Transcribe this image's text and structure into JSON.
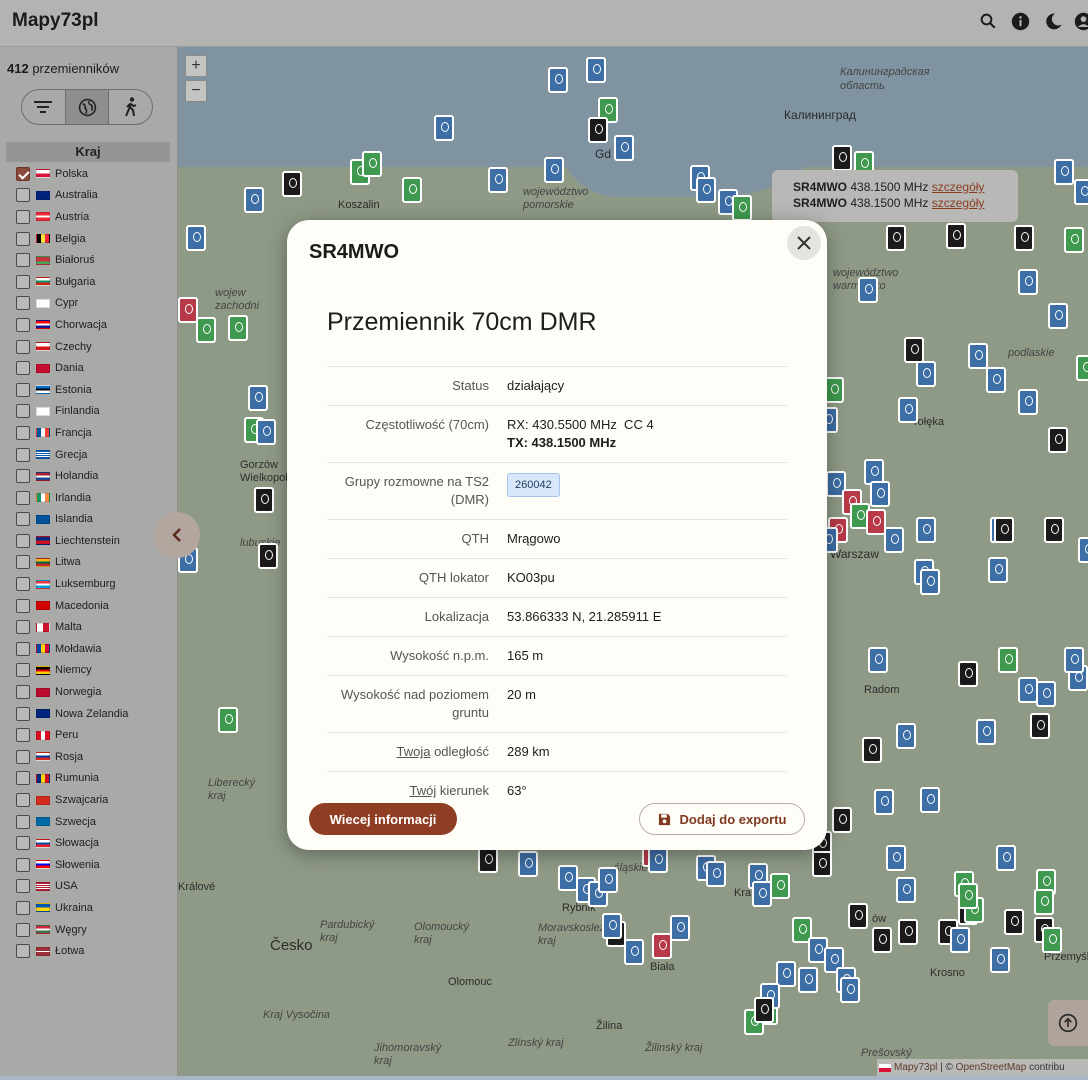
{
  "header": {
    "title": "Mapy73pl"
  },
  "sidebar": {
    "count_number": "412",
    "count_label": " przemienników",
    "kraj_header": "Kraj",
    "countries": [
      {
        "name": "Polska",
        "checked": true,
        "flag": "pl"
      },
      {
        "name": "Australia",
        "checked": false,
        "flag": "au"
      },
      {
        "name": "Austria",
        "checked": false,
        "flag": "at"
      },
      {
        "name": "Belgia",
        "checked": false,
        "flag": "be"
      },
      {
        "name": "Białoruś",
        "checked": false,
        "flag": "by"
      },
      {
        "name": "Bułgaria",
        "checked": false,
        "flag": "bg"
      },
      {
        "name": "Cypr",
        "checked": false,
        "flag": "cy"
      },
      {
        "name": "Chorwacja",
        "checked": false,
        "flag": "hr"
      },
      {
        "name": "Czechy",
        "checked": false,
        "flag": "cz"
      },
      {
        "name": "Dania",
        "checked": false,
        "flag": "dk"
      },
      {
        "name": "Estonia",
        "checked": false,
        "flag": "ee"
      },
      {
        "name": "Finlandia",
        "checked": false,
        "flag": "fi"
      },
      {
        "name": "Francja",
        "checked": false,
        "flag": "fr"
      },
      {
        "name": "Grecja",
        "checked": false,
        "flag": "gr"
      },
      {
        "name": "Holandia",
        "checked": false,
        "flag": "nl"
      },
      {
        "name": "Irlandia",
        "checked": false,
        "flag": "ie"
      },
      {
        "name": "Islandia",
        "checked": false,
        "flag": "is"
      },
      {
        "name": "Liechtenstein",
        "checked": false,
        "flag": "li"
      },
      {
        "name": "Litwa",
        "checked": false,
        "flag": "lt"
      },
      {
        "name": "Luksemburg",
        "checked": false,
        "flag": "lu"
      },
      {
        "name": "Macedonia",
        "checked": false,
        "flag": "mk"
      },
      {
        "name": "Malta",
        "checked": false,
        "flag": "mt"
      },
      {
        "name": "Mołdawia",
        "checked": false,
        "flag": "md"
      },
      {
        "name": "Niemcy",
        "checked": false,
        "flag": "de"
      },
      {
        "name": "Norwegia",
        "checked": false,
        "flag": "no"
      },
      {
        "name": "Nowa Zelandia",
        "checked": false,
        "flag": "nz"
      },
      {
        "name": "Peru",
        "checked": false,
        "flag": "pe"
      },
      {
        "name": "Rosja",
        "checked": false,
        "flag": "ru"
      },
      {
        "name": "Rumunia",
        "checked": false,
        "flag": "ro"
      },
      {
        "name": "Szwajcaria",
        "checked": false,
        "flag": "ch"
      },
      {
        "name": "Szwecja",
        "checked": false,
        "flag": "se"
      },
      {
        "name": "Słowacja",
        "checked": false,
        "flag": "sk"
      },
      {
        "name": "Słowenia",
        "checked": false,
        "flag": "si"
      },
      {
        "name": "USA",
        "checked": false,
        "flag": "us"
      },
      {
        "name": "Ukraina",
        "checked": false,
        "flag": "ua"
      },
      {
        "name": "Węgry",
        "checked": false,
        "flag": "hu"
      },
      {
        "name": "Łotwa",
        "checked": false,
        "flag": "lv"
      }
    ]
  },
  "map": {
    "labels": {
      "kaliningrad_oblast": "Калининградская область",
      "kaliningrad": "Калининград",
      "koszalin": "Koszalin",
      "pomorskie": "województwo pomorskie",
      "warminsko": "województwo warmińsko",
      "podlaskie": "podlaskie",
      "gorzow": "Gorzów Wielkopolski",
      "lubuskie": "lubuskie",
      "radom": "Radom",
      "liberecky": "Liberecký kraj",
      "krolove": "Králové",
      "cesko": "Česko",
      "pardubicky": "Pardubický kraj",
      "olomoucky": "Olomoucký kraj",
      "olomouc": "Olomouc",
      "rybnik": "Rybnik",
      "morawskoslaskie": "Moravskoslezský kraj",
      "biala": "Biała",
      "krosno": "Krosno",
      "przemysl": "Przemyśl",
      "zilina": "Žilina",
      "zilinsky": "Žilinský kraj",
      "presovsky": "Prešovský",
      "jihomoravsky": "Jihomoravský kraj",
      "zlinsky": "Zlínský kraj",
      "vysocina": "Kraj Vysočina",
      "olka": "rołęka",
      "warszawa": "Warszaw",
      "zachodnio": "wojew zachodni",
      "slaskie": "śląskie",
      "krakow": "Kra",
      "rzeszow": "ów",
      "gdansk": "Gd"
    },
    "tooltip": {
      "lines": [
        {
          "callsign": "SR4MWO",
          "freq": "438.1500 MHz",
          "link": "szczegóły"
        },
        {
          "callsign": "SR4MWO",
          "freq": "438.1500 MHz",
          "link": "szczegóły"
        }
      ]
    },
    "attribution": {
      "brand": "Mapy73pl",
      "sep": "| ©",
      "osm": "OpenStreetMap",
      "suffix": "contribu"
    },
    "zoom_in": "+",
    "zoom_out": "−"
  },
  "modal": {
    "title": "SR4MWO",
    "heading": "Przemiennik 70cm DMR",
    "rows": {
      "status_label": "Status",
      "status_value": "działający",
      "freq_label": "Częstotliwość (70cm)",
      "freq_rx": "RX: 430.5500 MHz  CC 4",
      "freq_tx": "TX: 438.1500 MHz",
      "groups_label": "Grupy rozmowne na TS2 (DMR)",
      "groups_badge": "260042",
      "qth_label": "QTH",
      "qth_value": "Mrągowo",
      "locator_label": "QTH lokator",
      "locator_value": "KO03pu",
      "location_label": "Lokalizacja",
      "location_value": "53.866333 N, 21.285911 E",
      "altitude_label": "Wysokość n.p.m.",
      "altitude_value": "165 m",
      "height_label": "Wysokość nad poziomem gruntu",
      "height_value": "20 m",
      "distance_label_link": "Twoja",
      "distance_label_rest": " odległość",
      "distance_value": "289 km",
      "bearing_label_link": "Twój",
      "bearing_label_rest": " kierunek",
      "bearing_value": "63°"
    },
    "more_button": "Wiecej informacji",
    "export_button": "Dodaj do exportu"
  },
  "colors": {
    "accent": "#8f3e23",
    "pin_blue": "#3d6ea6",
    "pin_green": "#3f9a4f",
    "pin_black": "#1a1a1a",
    "pin_red": "#b83a49"
  }
}
